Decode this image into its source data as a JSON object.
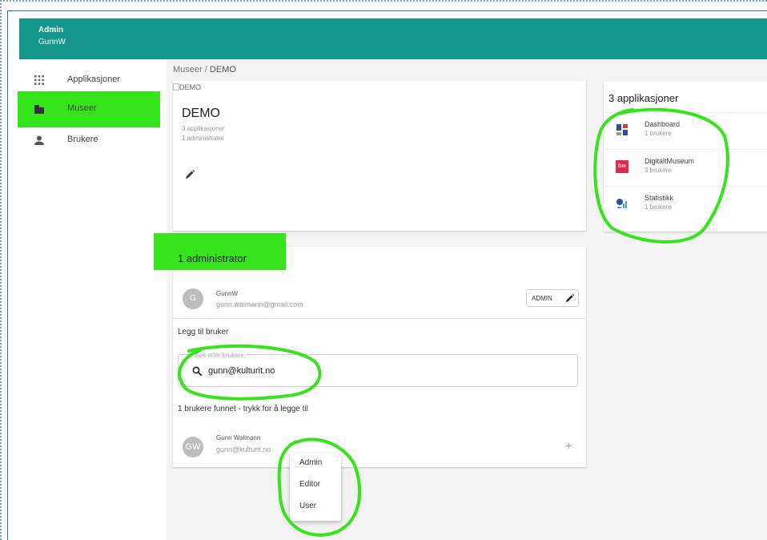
{
  "header": {
    "title": "Admin",
    "user": "GunnW",
    "color": "#15968a"
  },
  "sidebar": {
    "items": [
      {
        "label": "Applikasjoner",
        "icon": "apps-grid-icon"
      },
      {
        "label": "Museer",
        "icon": "museum-building-icon",
        "highlighted": true
      },
      {
        "label": "Brukere",
        "icon": "person-icon"
      }
    ]
  },
  "breadcrumb": {
    "parent": "Museer",
    "separator": "/",
    "current": "DEMO"
  },
  "organization": {
    "image_alt": "DEMO",
    "name": "DEMO",
    "apps_count": "3 applikasjoner",
    "admins_count": "1 administrator"
  },
  "applications": {
    "title": "3 applikasjoner",
    "items": [
      {
        "name": "Dashboard",
        "users": "1 brukere",
        "icon": "dashboard-icon"
      },
      {
        "name": "DigitaltMuseum",
        "users": "3 brukere",
        "icon": "digitaltmuseum-icon",
        "badge": "Dm"
      },
      {
        "name": "Statistikk",
        "users": "1 brukere",
        "icon": "statistics-icon"
      }
    ]
  },
  "administrators": {
    "title": "1 administrator",
    "users": [
      {
        "initials": "G",
        "name": "GunnW",
        "email": "gunn.walmann@gmail.com",
        "role": "ADMIN"
      }
    ]
  },
  "add_user": {
    "label": "Legg til bruker",
    "search_label": "Søk etter brukere",
    "search_value": "gunn@kulturit.no",
    "results_text": "1 brukere funnet - trykk for å legge til",
    "results": [
      {
        "initials": "GW",
        "name": "Gunn Walmann",
        "email": "gunn@kulturit.no"
      }
    ]
  },
  "role_menu": {
    "items": [
      "Admin",
      "Editor",
      "User"
    ]
  },
  "annotation_color": "#36e41c"
}
